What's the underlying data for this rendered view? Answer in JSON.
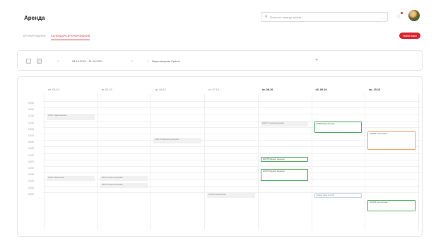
{
  "header": {
    "title": "Аренда",
    "search_placeholder": "Поиск по номеру заказа",
    "search_dropdown_icon": "chevron-down-icon",
    "notification_icon": "bell-icon",
    "avatar_icon": "user-avatar"
  },
  "tabs": [
    {
      "label": "бронирования",
      "active": false
    },
    {
      "label": "календарь бронирований",
      "active": true
    }
  ],
  "actions": {
    "new_order": "Новый заказ"
  },
  "toolbar": {
    "view_icons": [
      "list-view-icon",
      "calendar-view-icon"
    ],
    "prev_icon": "arrow-left-icon",
    "date_range": "04.10.2021 - 11.10.2021",
    "next_icon": "arrow-right-icon",
    "room_icon": "arrow-right-icon",
    "room": "Переговорная Python",
    "add_icon": "plus-icon"
  },
  "calendar": {
    "days": [
      {
        "label": "пн, 04.10",
        "bold": false
      },
      {
        "label": "вт, 05.10",
        "bold": false
      },
      {
        "label": "ср, 06.10",
        "bold": false
      },
      {
        "label": "чт, 07.10",
        "bold": false
      },
      {
        "label": "пт, 08.10",
        "bold": true
      },
      {
        "label": "сб, 09.10",
        "bold": true
      },
      {
        "label": "вс, 10.10",
        "bold": true
      }
    ],
    "times": [
      "09:00",
      "10:00",
      "11:00",
      "12:00",
      "13:00",
      "14:00",
      "15:00",
      "16:00",
      "17:00",
      "18:00",
      "19:00",
      "20:00",
      "21:00",
      "22:00",
      "23:00"
    ],
    "events": [
      {
        "day": 0,
        "start": 2.0,
        "end": 2.9,
        "style": "gray",
        "label": "100171 Данилевский"
      },
      {
        "day": 0,
        "start": 11.5,
        "end": 12.3,
        "style": "gray",
        "label": "100172 Ким Ролан"
      },
      {
        "day": 1,
        "start": 11.5,
        "end": 12.3,
        "style": "gray",
        "label": "100173 Анна Кузнецова"
      },
      {
        "day": 1,
        "start": 12.6,
        "end": 13.4,
        "style": "gray",
        "label": "100174 Анна Кузнецова"
      },
      {
        "day": 2,
        "start": 5.7,
        "end": 6.5,
        "style": "gray",
        "label": "100175 Марина Кузнецова"
      },
      {
        "day": 3,
        "start": 14.1,
        "end": 14.9,
        "style": "gray",
        "label": "100176 Анна Ролан"
      },
      {
        "day": 4,
        "start": 3.1,
        "end": 3.9,
        "style": "gray",
        "label": "100177 Сергей Кузнецов"
      },
      {
        "day": 4,
        "start": 8.6,
        "end": 9.4,
        "style": "green",
        "label": "100178 Михаил Андреев"
      },
      {
        "day": 4,
        "start": 10.4,
        "end": 12.3,
        "style": "green",
        "label": "100179 Михаил Андреев"
      },
      {
        "day": 5,
        "start": 3.1,
        "end": 4.9,
        "style": "green",
        "label": "100180 Иван Петров"
      },
      {
        "day": 5,
        "start": 14.1,
        "end": 14.9,
        "style": "outline",
        "label": "Новый заказ в 20:00"
      },
      {
        "day": 6,
        "start": 4.7,
        "end": 7.5,
        "style": "orange",
        "label": "100181 Алла Ганей"
      },
      {
        "day": 6,
        "start": 15.2,
        "end": 17.0,
        "style": "green",
        "label": "100182 Артем Кузин"
      }
    ]
  }
}
